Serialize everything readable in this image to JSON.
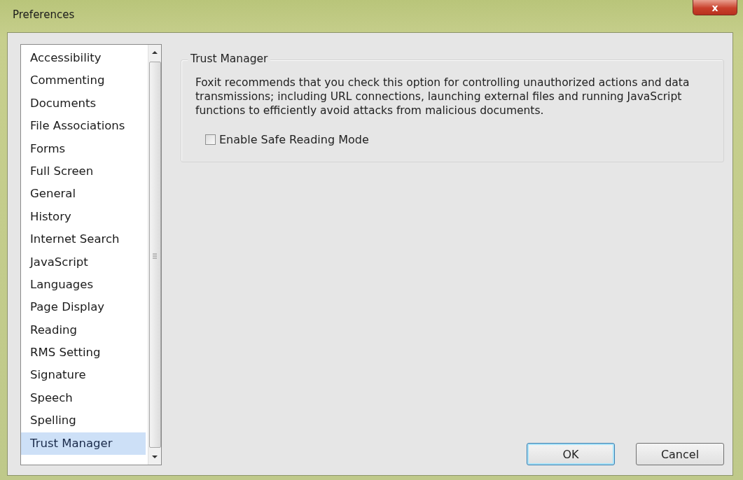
{
  "window": {
    "title": "Preferences",
    "close": "x"
  },
  "sidebar": {
    "items": [
      {
        "label": "Accessibility",
        "selected": false
      },
      {
        "label": "Commenting",
        "selected": false
      },
      {
        "label": "Documents",
        "selected": false
      },
      {
        "label": "File Associations",
        "selected": false
      },
      {
        "label": "Forms",
        "selected": false
      },
      {
        "label": "Full Screen",
        "selected": false
      },
      {
        "label": "General",
        "selected": false
      },
      {
        "label": "History",
        "selected": false
      },
      {
        "label": "Internet Search",
        "selected": false
      },
      {
        "label": "JavaScript",
        "selected": false
      },
      {
        "label": "Languages",
        "selected": false
      },
      {
        "label": "Page Display",
        "selected": false
      },
      {
        "label": "Reading",
        "selected": false
      },
      {
        "label": "RMS Setting",
        "selected": false
      },
      {
        "label": "Signature",
        "selected": false
      },
      {
        "label": "Speech",
        "selected": false
      },
      {
        "label": "Spelling",
        "selected": false
      },
      {
        "label": "Trust Manager",
        "selected": true
      }
    ]
  },
  "group": {
    "title": "Trust Manager",
    "description": "Foxit recommends that you check this option for controlling unauthorized actions and data transmissions; including URL connections, launching external files and running JavaScript functions to efficiently avoid attacks from malicious documents.",
    "option": {
      "label": "Enable Safe Reading Mode",
      "checked": false
    }
  },
  "buttons": [
    {
      "label": "OK",
      "default": true
    },
    {
      "label": "Cancel",
      "default": false
    }
  ]
}
